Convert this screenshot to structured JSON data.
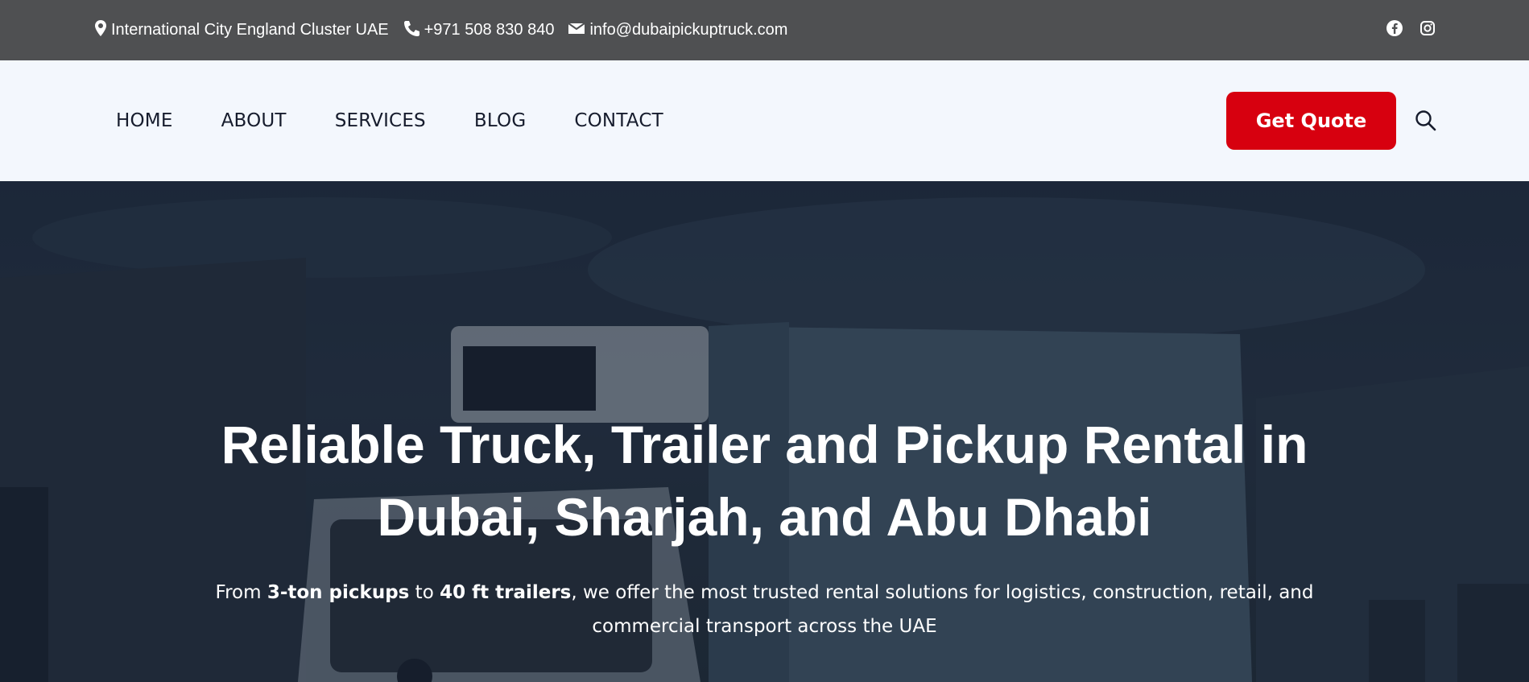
{
  "topbar": {
    "address": "International City England Cluster UAE",
    "phone": "+971 508 830 840",
    "email": "info@dubaipickuptruck.com",
    "social_icons": [
      "facebook-icon",
      "instagram-icon"
    ]
  },
  "nav": {
    "items": [
      "HOME",
      "ABOUT",
      "SERVICES",
      "BLOG",
      "CONTACT"
    ],
    "cta_label": "Get Quote",
    "search_icon": "search-icon"
  },
  "hero": {
    "title_line1": "Reliable Truck, Trailer and Pickup Rental in",
    "title_line2": "Dubai, Sharjah, and Abu Dhabi",
    "sub_prefix": "From ",
    "sub_bold1": "3-ton pickups",
    "sub_mid": " to ",
    "sub_bold2": "40 ft trailers",
    "sub_rest": ", we offer the most trusted rental solutions for logistics, construction, retail, and commercial transport across the UAE"
  },
  "colors": {
    "topbar_bg": "#4f5052",
    "header_bg": "#f3f7fd",
    "accent": "#d7000f",
    "nav_text": "#161c2d"
  }
}
